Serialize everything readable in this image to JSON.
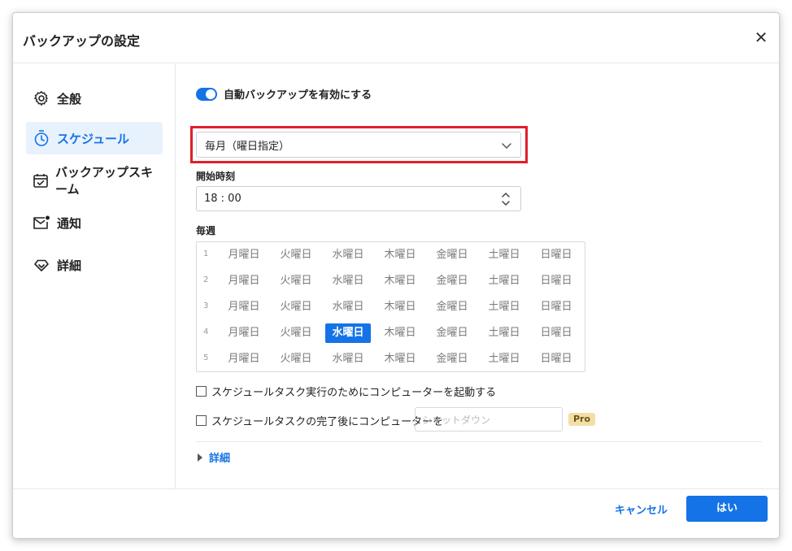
{
  "dialog": {
    "title": "バックアップの設定",
    "close_label": "✕"
  },
  "sidebar": {
    "items": [
      {
        "label": "全般",
        "icon": "gear-icon"
      },
      {
        "label": "スケジュール",
        "icon": "timer-icon",
        "active": true
      },
      {
        "label": "バックアップスキーム",
        "icon": "calendar-check-icon"
      },
      {
        "label": "通知",
        "icon": "mail-icon"
      },
      {
        "label": "詳細",
        "icon": "diamond-icon"
      }
    ]
  },
  "main": {
    "auto_backup": {
      "label": "自動バックアップを有効にする",
      "enabled": true
    },
    "frequency": {
      "value": "毎月（曜日指定）"
    },
    "start_time": {
      "label": "開始時刻",
      "value": "18 : 00"
    },
    "weekly": {
      "label": "毎週",
      "weeks": [
        "1",
        "2",
        "3",
        "4",
        "5"
      ],
      "days": [
        "月曜日",
        "火曜日",
        "水曜日",
        "木曜日",
        "金曜日",
        "土曜日",
        "日曜日"
      ],
      "selected": {
        "week": "4",
        "day": "水曜日"
      }
    },
    "wake_option": {
      "label": "スケジュールタスク実行のためにコンピューターを起動する",
      "checked": false
    },
    "after_option": {
      "label": "スケジュールタスクの完了後にコンピューターを",
      "checked": false,
      "placeholder": "シャットダウン",
      "badge": "Pro"
    },
    "details": {
      "label": "詳細"
    }
  },
  "footer": {
    "cancel_label": "キャンセル",
    "ok_label": "はい"
  },
  "colors": {
    "accent": "#1473e6",
    "highlight": "#e01f2b",
    "badge_bg": "#f3dfa5"
  }
}
